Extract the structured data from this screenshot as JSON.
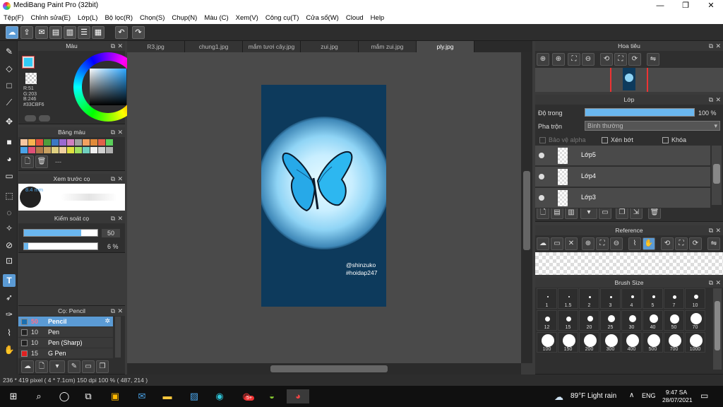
{
  "window": {
    "title": "MediBang Paint Pro (32bit)",
    "min": "—",
    "max": "❐",
    "close": "✕"
  },
  "menu": [
    "Tệp(F)",
    "Chỉnh sửa(E)",
    "Lớp(L)",
    "Bộ lọc(R)",
    "Chọn(S)",
    "Chụp(N)",
    "Màu (C)",
    "Xem(V)",
    "Công cụ(T)",
    "Cửa sổ(W)",
    "Cloud",
    "Help"
  ],
  "colors": {
    "accent": "#5b9bd5",
    "current": "#33CBF6",
    "panel": "#2f2f2f"
  },
  "color_panel": {
    "title": "Màu",
    "r": "R:51",
    "g": "G:203",
    "b": "B:246",
    "hex": "#33CBF6"
  },
  "palette_panel": {
    "title": "Bảng màu",
    "dash": "---"
  },
  "brush_preview": {
    "title": "Xem trước cọ",
    "size": "8.4 mm"
  },
  "brush_control": {
    "title": "Kiểm soát cọ",
    "size_value": "50",
    "opacity_value": "6 %",
    "size_fill": 0.78,
    "opacity_fill": 0.06
  },
  "brush_list": {
    "title": "Cọ: Pencil",
    "items": [
      {
        "size": "50",
        "name": "Pencil",
        "color": "#1a6fb0",
        "selected": true
      },
      {
        "size": "10",
        "name": "Pen",
        "color": "#222222",
        "selected": false
      },
      {
        "size": "10",
        "name": "Pen (Sharp)",
        "color": "#222222",
        "selected": false
      },
      {
        "size": "15",
        "name": "G Pen",
        "color": "#e02020",
        "selected": false
      }
    ]
  },
  "tabs": [
    "R3.jpg",
    "chung1.jpg",
    "mắm tươi cây.jpg",
    "zui.jpg",
    "mắm zui.jpg",
    "ply.jpg"
  ],
  "canvas": {
    "watermark_1": "@shinzuko",
    "watermark_2": "#hoidap247"
  },
  "status": {
    "text": "236 * 419 pixel   ( 4 * 7.1cm)   150 dpi   100 %   ( 487, 214 )"
  },
  "navigator": {
    "title": "Hoa tiêu"
  },
  "layers": {
    "title": "Lớp",
    "opacity_label": "Độ trong",
    "opacity_value": "100 %",
    "blend_label": "Pha trộn",
    "blend_value": "Bình thường",
    "protect_alpha": "Bảo vệ alpha",
    "clipping": "Xén bớt",
    "lock": "Khóa",
    "items": [
      {
        "name": "Lớp5"
      },
      {
        "name": "Lớp4"
      },
      {
        "name": "Lớp3"
      }
    ]
  },
  "reference": {
    "title": "Reference"
  },
  "brush_size": {
    "title": "Brush Size",
    "sizes": [
      "1",
      "1.5",
      "2",
      "3",
      "4",
      "5",
      "7",
      "10",
      "12",
      "15",
      "20",
      "25",
      "30",
      "40",
      "50",
      "70",
      "100",
      "150",
      "200",
      "300",
      "400",
      "500",
      "700",
      "1000"
    ]
  },
  "taskbar": {
    "weather": "89°F  Light rain",
    "lang": "ENG",
    "time": "9:47 SA",
    "date": "28/07/2021",
    "badge": "5+"
  }
}
